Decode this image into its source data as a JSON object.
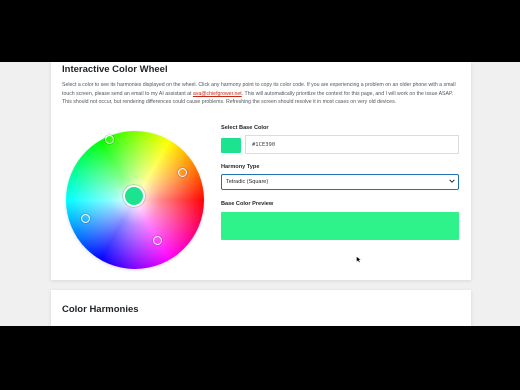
{
  "colors": {
    "accent": "#2271b1",
    "link": "#c42a16",
    "base": "#1CE390",
    "page_bg": "#f0f0f1",
    "card_bg": "#ffffff"
  },
  "wheel_card": {
    "title": "Interactive Color Wheel",
    "description_before_email": "Select a color to see its harmonies displayed on the wheel. Click any harmony point to copy its color code. If you are experiencing a problem on an older phone with a small touch screen, please send an email to my AI assistant at ",
    "email": "ava@chiefgrower.net",
    "description_after_email": ". This will automatically prioritize the context for this page, and I will work on the issue ASAP. This should not occur, but rendering differences could cause problems. Refreshing the screen should resolve it in most cases on very old devices.",
    "base_color_label": "Select Base Color",
    "hex_value": "#1CE390",
    "harmony_type_label": "Harmony Type",
    "harmony_type_selected": "Tetradic (Square)",
    "preview_label": "Base Color Preview",
    "icons": {
      "select_chevron": "chevron-down-icon",
      "pointer": "mouse-pointer-icon"
    }
  },
  "harmonies_card": {
    "title": "Color Harmonies"
  }
}
